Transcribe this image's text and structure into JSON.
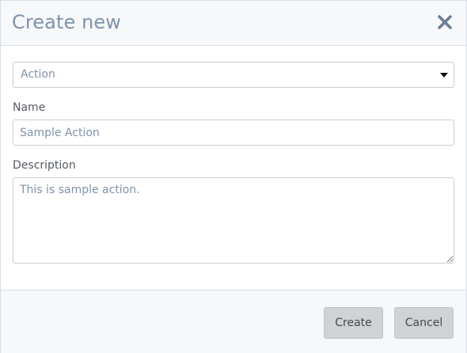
{
  "dialog": {
    "title": "Create new",
    "close_icon": "close-icon"
  },
  "form": {
    "type_select": {
      "selected": "Action",
      "icon": "caret-down-icon"
    },
    "name": {
      "label": "Name",
      "value": "Sample Action"
    },
    "description": {
      "label": "Description",
      "value": "This is sample action."
    }
  },
  "footer": {
    "create_label": "Create",
    "cancel_label": "Cancel"
  },
  "colors": {
    "title": "#7f93ab",
    "field_text": "#7f93ab",
    "header_bg": "#f7f8fa",
    "button_bg": "#d0d2d4"
  }
}
